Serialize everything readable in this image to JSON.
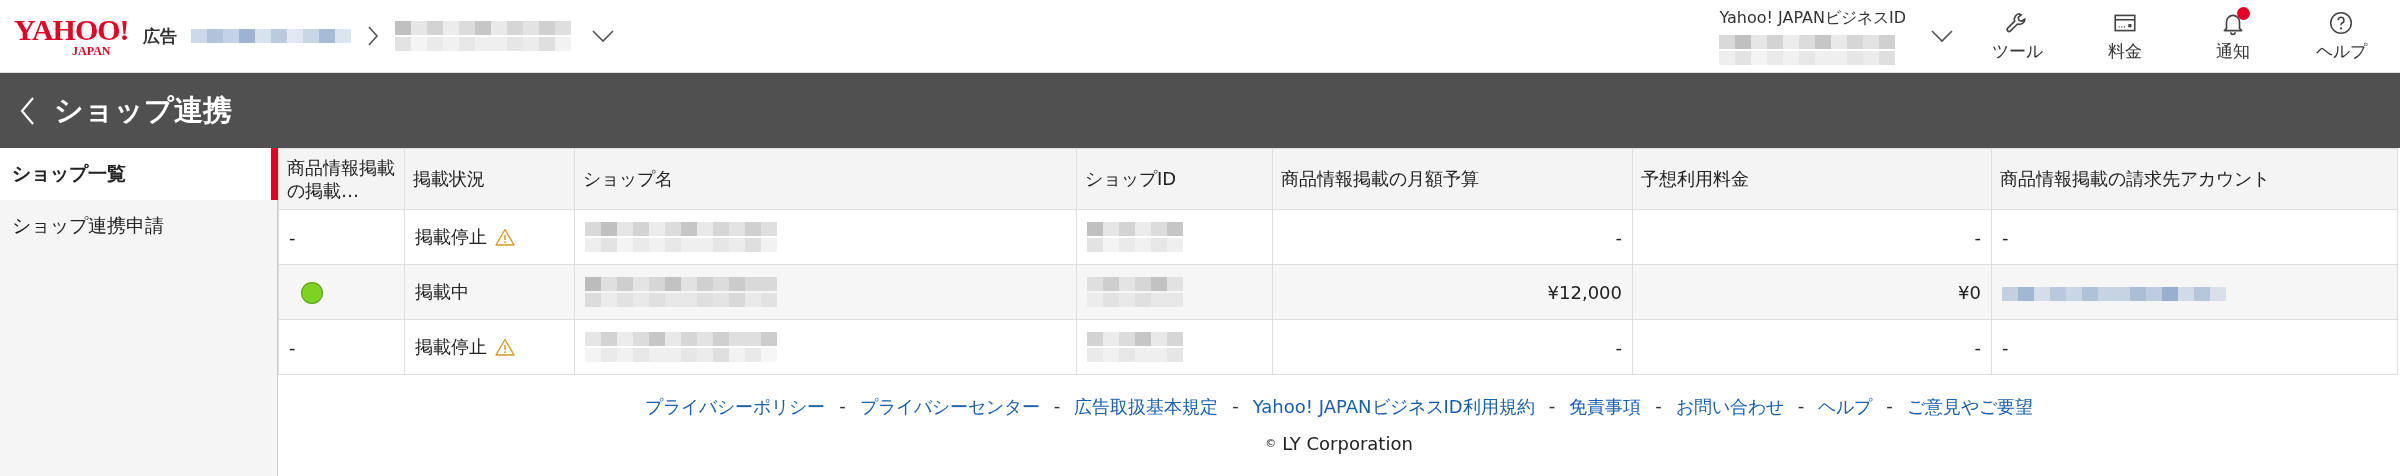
{
  "header": {
    "logo": {
      "name": "YAHOO!",
      "sub": "JAPAN"
    },
    "service": "広告",
    "breadcrumb": [
      {
        "kind": "blurred_link"
      },
      {
        "kind": "blurred"
      }
    ],
    "account": {
      "label": "Yahoo! JAPANビジネスID",
      "value": {
        "kind": "blurred"
      }
    },
    "tools": [
      {
        "kind": "wrench",
        "label": "ツール",
        "badge": false
      },
      {
        "kind": "card",
        "label": "料金",
        "badge": false
      },
      {
        "kind": "bell",
        "label": "通知",
        "badge": true
      },
      {
        "kind": "help",
        "label": "ヘルプ",
        "badge": false
      }
    ]
  },
  "page_title": "ショップ連携",
  "sidebar": {
    "items": [
      {
        "label": "ショップ一覧",
        "selected": true
      },
      {
        "label": "ショップ連携申請",
        "selected": false
      }
    ]
  },
  "table": {
    "columns": [
      "商品情報掲載の掲載…",
      "掲載状況",
      "ショップ名",
      "ショップID",
      "商品情報掲載の月額予算",
      "予想利用料金",
      "商品情報掲載の請求先アカウント"
    ],
    "rows": [
      {
        "cells": [
          {
            "kind": "text",
            "text": "-"
          },
          {
            "kind": "status",
            "text": "掲載停止",
            "warning": true
          },
          {
            "kind": "blurred"
          },
          {
            "kind": "blurred"
          },
          {
            "kind": "number",
            "text": "-"
          },
          {
            "kind": "number",
            "text": "-"
          },
          {
            "kind": "text",
            "text": "-"
          }
        ]
      },
      {
        "cells": [
          {
            "kind": "dot",
            "color": "#7ed321"
          },
          {
            "kind": "status",
            "text": "掲載中",
            "warning": false
          },
          {
            "kind": "blurred"
          },
          {
            "kind": "blurred"
          },
          {
            "kind": "number",
            "text": "¥12,000"
          },
          {
            "kind": "number",
            "text": "¥0"
          },
          {
            "kind": "blurred_link"
          }
        ]
      },
      {
        "cells": [
          {
            "kind": "text",
            "text": "-"
          },
          {
            "kind": "status",
            "text": "掲載停止",
            "warning": true
          },
          {
            "kind": "blurred"
          },
          {
            "kind": "blurred"
          },
          {
            "kind": "number",
            "text": "-"
          },
          {
            "kind": "number",
            "text": "-"
          },
          {
            "kind": "text",
            "text": "-"
          }
        ]
      }
    ]
  },
  "footer": {
    "links": [
      "プライバシーポリシー",
      "プライバシーセンター",
      "広告取扱基本規定",
      "Yahoo! JAPANビジネスID利用規約",
      "免責事項",
      "お問い合わせ",
      "ヘルプ",
      "ご意見やご要望"
    ],
    "separator": "-",
    "copyright_mark": "©",
    "copyright": "LY Corporation"
  }
}
